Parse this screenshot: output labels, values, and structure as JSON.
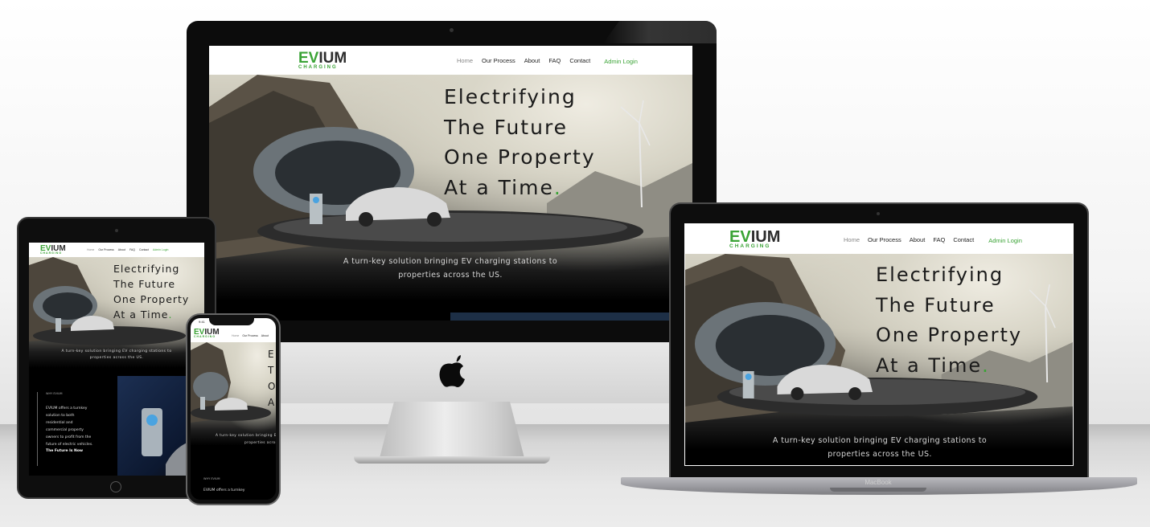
{
  "site": {
    "logo_ev": "EV",
    "logo_ium": "IUM",
    "logo_sub": "CHARGING",
    "nav": [
      "Home",
      "Our Process",
      "About",
      "FAQ",
      "Contact",
      "Admin Login"
    ],
    "headline": [
      "Electrifying",
      "The Future",
      "One Property",
      "At a Time"
    ],
    "headline_dot": ".",
    "tagline_line1": "A turn-key solution bringing EV charging stations to",
    "tagline_line2": "properties across the US.",
    "why_label": "WHY EVIUM",
    "why_text": [
      "EVIUM offers a turnkey",
      "solution to both",
      "residential and",
      "commercial property",
      "owners to profit from the",
      "future of electric vehicles."
    ],
    "why_cta": "The Future Is Now",
    "phone_text": "EVIUM offers a turnkey"
  },
  "devices": {
    "macbook_label": "MacBook",
    "phone_time": "9:41"
  },
  "colors": {
    "brand_green": "#3aa335",
    "logo_dark": "#2c2c2c",
    "hero_text": "#1a1a1a"
  }
}
